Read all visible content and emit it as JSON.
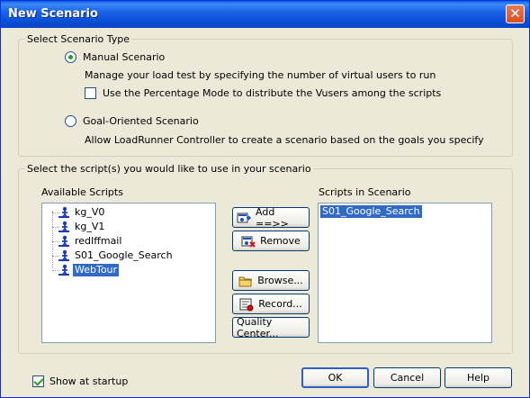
{
  "window": {
    "title": "New Scenario",
    "close_symbol": "✕"
  },
  "scenario_type": {
    "group_title": "Select Scenario Type",
    "manual": {
      "label": "Manual Scenario",
      "selected": true,
      "description": "Manage your load test by specifying the number of virtual users to run",
      "percentage_label": "Use the Percentage Mode to distribute the Vusers among the scripts",
      "percentage_checked": false
    },
    "goal": {
      "label": "Goal-Oriented Scenario",
      "selected": false,
      "description": "Allow LoadRunner Controller to create a scenario based on the goals you specify"
    }
  },
  "scripts": {
    "group_title": "Select the script(s) you would like to use in your scenario",
    "available_label": "Available Scripts",
    "available": [
      "kg_V0",
      "kg_V1",
      "redIffmail",
      "S01_Google_Search",
      "WebTour"
    ],
    "selected_available": "WebTour",
    "in_scenario_label": "Scripts in Scenario",
    "in_scenario": [
      "S01_Google_Search"
    ]
  },
  "buttons": {
    "add": "Add ==>>",
    "remove": "Remove",
    "browse": "Browse...",
    "record": "Record...",
    "quality_center": "Quality Center...",
    "ok": "OK",
    "cancel": "Cancel",
    "help": "Help"
  },
  "footer": {
    "show_at_startup_label": "Show at startup",
    "show_at_startup_checked": true
  },
  "colors": {
    "selection": "#316ac5",
    "title_bar": "#0a4fd6",
    "dialog_bg": "#ece9d8"
  }
}
